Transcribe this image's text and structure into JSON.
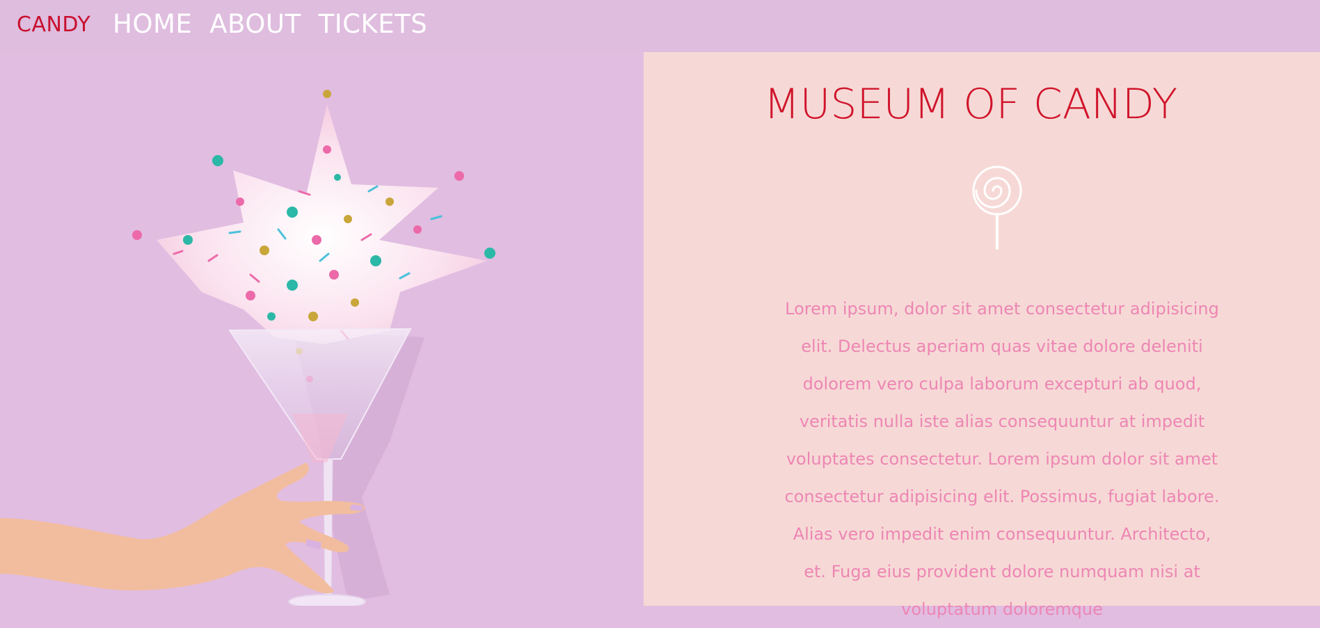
{
  "nav": {
    "logo": "CANDY",
    "links": [
      "HOME",
      "ABOUT",
      "TICKETS"
    ]
  },
  "hero": {
    "image_alt": "hand holding a martini glass with candy sprinkles bursting out"
  },
  "panel": {
    "title": "MUSEUM OF CANDY",
    "icon": "lollipop-icon",
    "body": "Lorem ipsum, dolor sit amet consectetur adipisicing elit. Delectus aperiam quas vitae dolore deleniti dolorem vero culpa laborum excepturi ab quod, veritatis nulla iste alias consequuntur at impedit voluptates consectetur. Lorem ipsum dolor sit amet consectetur adipisicing elit. Possimus, fugiat labore. Alias vero impedit enim consequuntur. Architecto, et. Fuga eius provident dolore numquam nisi at voluptatum doloremque"
  },
  "colors": {
    "background": "#e1bde1",
    "panel": "#f6d9d6",
    "accent": "#d0142b",
    "body_text": "#ed86b4",
    "nav_text": "#ffffff"
  }
}
